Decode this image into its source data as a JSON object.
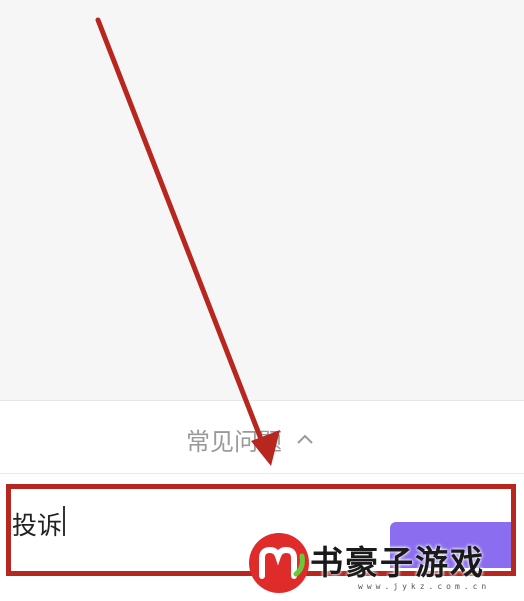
{
  "faq": {
    "label": "常见问题"
  },
  "input": {
    "value": "投诉"
  },
  "watermark": {
    "brand": "书豪子游戏",
    "url": "www.jykz.com.cn"
  },
  "colors": {
    "accent": "#8b6ef0",
    "annotation": "#b7261f"
  },
  "icons": {
    "faq_toggle": "chevron-up-icon",
    "annotation": "arrow-annotation"
  }
}
